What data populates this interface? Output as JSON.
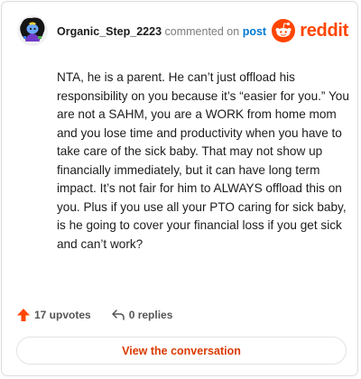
{
  "comment": {
    "username": "Organic_Step_2223",
    "action_text": "commented on",
    "post_link": "post",
    "body": "NTA, he is a parent. He can’t just offload his responsibility on you because it’s “easier for you.” You are not a SAHM, you are a WORK from home mom and you lose time and productivity when you have to take care of the sick baby. That may not show up financially immediately, but it can have long term impact. It’s not fair for him to ALWAYS offload this on you. Plus if you use all your PTO caring for sick baby, is he going to cover your financial loss if you get sick and can’t work?",
    "upvotes": "17 upvotes",
    "replies": "0 replies"
  },
  "brand": {
    "wordmark": "reddit",
    "color": "#ff4500"
  },
  "cta": {
    "label": "View the conversation",
    "color": "#d93a00"
  },
  "icons": [
    "avatar-icon",
    "reddit-logo-icon",
    "upvote-arrow-icon",
    "reply-arrow-icon"
  ]
}
